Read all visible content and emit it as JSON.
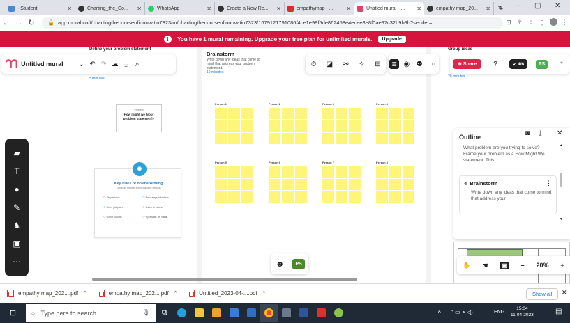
{
  "browser": {
    "tabs": [
      {
        "label": "- Student",
        "color": "#4a88d6"
      },
      {
        "label": "Charting_the_Co...",
        "color": "#333333"
      },
      {
        "label": "WhatsApp",
        "color": "#25d366"
      },
      {
        "label": "Create a New Re...",
        "color": "#333333"
      },
      {
        "label": "empathymap - ...",
        "color": "#d93025"
      },
      {
        "label": "Untitled mural - ...",
        "color": "#e8406a"
      },
      {
        "label": "empathy map_20...",
        "color": "#333333"
      }
    ],
    "new_tab": "+",
    "url": "app.mural.co/t/chartingthecourseofinnovatio7323/m/chartingthecourseofinnovatio7323/1679121791086/4ce1e98f5de862458e4ecee8e8f0ae97c32b9b9b?sender=..."
  },
  "banner": {
    "text": "You have 1 mural remaining. Upgrade your free plan for unlimited murals.",
    "button": "Upgrade"
  },
  "mural": {
    "title": "Untitled mural",
    "share": "Share",
    "timer_count": "4/6",
    "avatar": "PS",
    "left_area": {
      "title": "Define your problem statement",
      "timer": "5 minutes"
    },
    "problem_card": {
      "title": "Problem",
      "text": "How might we [your problem statement]?"
    },
    "rules_card": {
      "title": "Key rules of brainstorming",
      "subtitle": "To run an smooth and productive session",
      "rules": [
        "Stay in topic.",
        "Encourage wild ideas.",
        "Defer judgment.",
        "Listen to others.",
        "Go for volume.",
        "If possible, be visual."
      ]
    },
    "brainstorm": {
      "title": "Brainstorm",
      "subtitle": "Write down any ideas that come to mind that address your problem statement.",
      "timer": "10 minutes",
      "persons": [
        "Person 1",
        "Person 2",
        "Person 3",
        "Person 4",
        "Person 5",
        "Person 6",
        "Person 7",
        "Person 8"
      ]
    },
    "right_area": {
      "title": "Group ideas",
      "timer": "20 minutes"
    }
  },
  "outline": {
    "title": "Outline",
    "card1_text": "What problem are you trying to solve? Frame your problem as a How Might We statement. This",
    "card2_number": "4",
    "card2_title": "Brainstorm",
    "card2_text": "Write down any ideas that come to mind that address your"
  },
  "zoom": {
    "level": "20%",
    "minus": "–",
    "plus": "+"
  },
  "downloads": {
    "items": [
      "empathy map_202....pdf",
      "empathy map_202....pdf",
      "Untitled_2023-04-....pdf"
    ],
    "show_all": "Show all"
  },
  "taskbar": {
    "search_placeholder": "Type here to search",
    "lang": "ENG",
    "time": "15:04",
    "date": "11-04-2023"
  }
}
